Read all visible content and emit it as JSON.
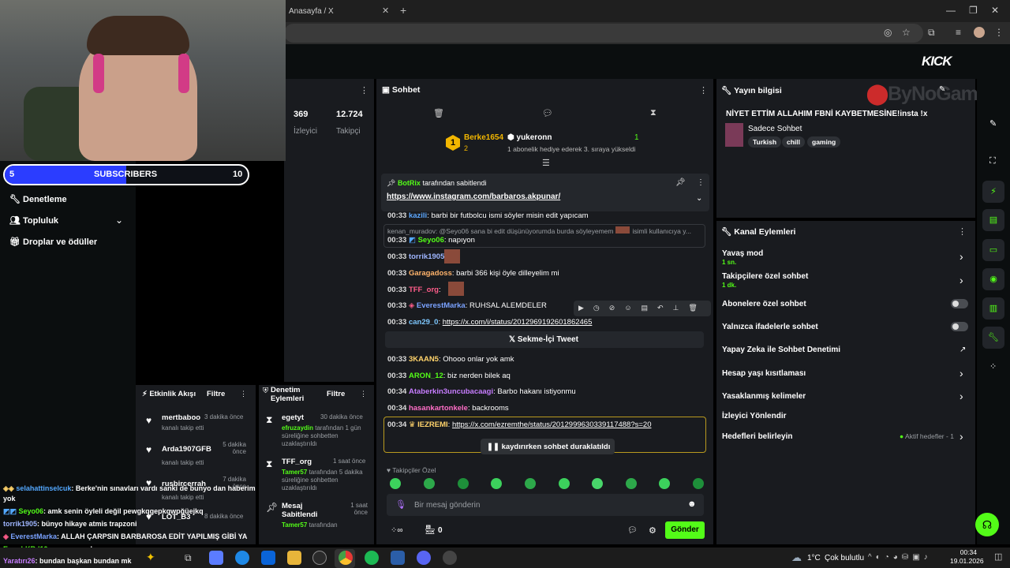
{
  "browser": {
    "tab_title": "Anasayfa / X",
    "close": "✕",
    "newtab": "+",
    "min": "—",
    "max": "❐",
    "xclose": "✕"
  },
  "kick": {
    "logo": "KICK"
  },
  "overlay": {
    "sub_left": "5",
    "sub_label": "SUBSCRIBERS",
    "sub_right": "10",
    "watermark": "ByNoGame"
  },
  "left": {
    "items": [
      {
        "label": "Denetleme"
      },
      {
        "label": "Topluluk"
      },
      {
        "label": "Droplar ve ödüller"
      }
    ]
  },
  "stats": {
    "viewers": "369",
    "viewers_label": "İzleyici",
    "followers": "12.724",
    "followers_label": "Takipçi"
  },
  "chat": {
    "title": "Sohbet",
    "top_user": "Berke1654",
    "top_count": "2",
    "top_rank": "1",
    "gifter": "yukeronn",
    "gifter_count": "1",
    "gifter_note": "1 abonelik hediye ederek 3. sıraya yükseldi",
    "pinned_by": "BotRix",
    "pinned_suffix": "tarafından sabitlendi",
    "pinned_link": "https://www.instagram.com/barbaros.akpunar/",
    "reply_preview": "kenan_muradov: @Seyo06 sana bi edit düşünüyorumda burda söyleyemem",
    "reply_preview2": "isimli kullanıcıya y...",
    "messages": [
      {
        "t": "00:33",
        "u": "kazili",
        "m": ": barbi bir futbolcu ismi söyler misin edit yapıcam",
        "c": "#5da8ff"
      },
      {
        "t": "00:33",
        "u": "Seyo06",
        "m": ": napıyon",
        "c": "#53fc18"
      },
      {
        "t": "00:33",
        "u": "torrik1905",
        "m": ":",
        "c": "#9fb6ff"
      },
      {
        "t": "00:33",
        "u": "Garagadoss",
        "m": ": barbi 366 kişi öyle dilleyelim mi",
        "c": "#ffb36b"
      },
      {
        "t": "00:33",
        "u": "TFF_org",
        "m": ":",
        "c": "#ff5c8a"
      },
      {
        "t": "00:33",
        "u": "EverestMarka",
        "m": ": RUHSAL ALEMDELER",
        "c": "#7aa2ff"
      },
      {
        "t": "00:33",
        "u": "can29_0",
        "m": ": ",
        "c": "#7ec8ff"
      },
      {
        "t": "00:33",
        "u": "3KAAN5",
        "m": ": Ohooo onlar yok amk",
        "c": "#ffd36b"
      },
      {
        "t": "00:33",
        "u": "ARON_12",
        "m": ": biz nerden bilek aq",
        "c": "#53fc18"
      },
      {
        "t": "00:34",
        "u": "Ataberkin3uncubacaagi",
        "m": ": Barbo hakanı istiyonmu",
        "c": "#c77dff"
      },
      {
        "t": "00:34",
        "u": "hasankartonkele",
        "m": ": backrooms",
        "c": "#ff6ec7"
      },
      {
        "t": "00:34",
        "u": "IEZREMI",
        "m": ": ",
        "c": "#ffd36b"
      }
    ],
    "link1": "https://x.com/i/status/2012969192601862465",
    "tweet_embed": "Sekme-İçi Tweet",
    "link2": "https://x.com/ezremthe/status/2012999630339117488?s=20",
    "paused": "kaydırırken sohbet duraklatıldı",
    "followers_only": "Takipçiler Özel",
    "input_placeholder": "Bir mesaj gönderin",
    "points": "0",
    "send": "Gönder"
  },
  "info": {
    "title": "Yayın bilgisi",
    "stream_title": "NİYET ETTİM ALLAHIM FBNİ KAYBETMESİNE!insta !x",
    "category": "Sadece Sohbet",
    "tags": [
      "Turkish",
      "chill",
      "gaming"
    ]
  },
  "actions": {
    "title": "Kanal Eylemleri",
    "slow": "Yavaş mod",
    "slow_val": "1 sn.",
    "follow": "Takipçilere özel sohbet",
    "follow_val": "1 dk.",
    "subs": "Abonelere özel sohbet",
    "emotes": "Yalnızca ifadelerle sohbet",
    "ai": "Yapay Zeka ile Sohbet Denetimi",
    "age": "Hesap yaşı kısıtlaması",
    "banned": "Yasaklanmış kelimeler",
    "redirect": "İzleyici Yönlendir",
    "goals": "Hedefleri belirleyin",
    "goals_val": "Aktif hedefler - 1"
  },
  "feed": {
    "title": "Etkinlik Akışı",
    "filter": "Filtre",
    "items": [
      {
        "user": "mertbaboo",
        "time": "3 dakika önce",
        "note": "kanalı takip etti"
      },
      {
        "user": "Arda1907GFB",
        "time": "5 dakika önce",
        "note": "kanalı takip etti"
      },
      {
        "user": "rusbircerrah",
        "time": "7 dakika önce",
        "note": "kanalı takip etti"
      },
      {
        "user": "LOT_B3",
        "time": "8 dakika önce",
        "note": ""
      }
    ]
  },
  "mod": {
    "title": "Denetim Eylemleri",
    "filter": "Filtre",
    "items": [
      {
        "user": "egetyt",
        "time": "30 dakika önce",
        "by": "efruzaydin",
        "note": "tarafından 1 gün süreliğine sohbetten uzaklaştırıldı"
      },
      {
        "user": "TFF_org",
        "time": "1 saat önce",
        "by": "Tamer57",
        "note": "tarafından 5 dakika süreliğine sohbetten uzaklaştırıldı"
      },
      {
        "user": "Mesaj Sabitlendi",
        "time": "1 saat önce",
        "by": "Tamer57",
        "note": "tarafından"
      }
    ]
  },
  "overlay_chat": [
    {
      "u": "selahattinselcuk",
      "m": ": Berke'nin sınavları vardı sanki de bunyo dan haberim",
      "c": "#53a8ff"
    },
    {
      "u": "",
      "m": "yok",
      "c": "#fff"
    },
    {
      "u": "Seyo06",
      "m": ": amk senin öyleli değil pewgkqgepkqwpğüejkq",
      "c": "#53fc18"
    },
    {
      "u": "torrik1905",
      "m": ": bünyo hikaye atmis trapzoni",
      "c": "#9fb6ff"
    },
    {
      "u": "EverestMarka",
      "m": ": ALLAH ÇARPSIN BARBAROSA EDİT YAPILMIŞ GİBİ YA",
      "c": "#7aa2ff"
    },
    {
      "u": "EmrahKRd10",
      "m": ": yayın açıyolar",
      "c": "#53fc18"
    },
    {
      "u": "Yaratırı26",
      "m": ": bundan başkan bundan mk",
      "c": "#c77dff"
    }
  ],
  "taskbar": {
    "weather": "1°C",
    "weather_text": "Çok bulutlu",
    "time": "00:34",
    "date": "19.01.2026"
  }
}
